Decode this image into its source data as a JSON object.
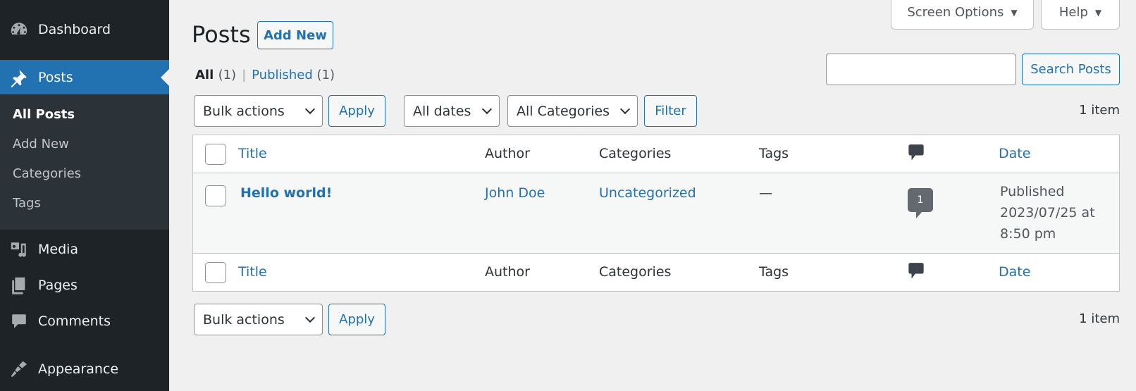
{
  "sidebar": {
    "items": [
      {
        "label": "Dashboard",
        "icon": "dashboard-icon"
      },
      {
        "label": "Posts",
        "icon": "pushpin-icon",
        "current": true
      },
      {
        "label": "Media",
        "icon": "media-icon"
      },
      {
        "label": "Pages",
        "icon": "pages-icon"
      },
      {
        "label": "Comments",
        "icon": "comment-icon"
      },
      {
        "label": "Appearance",
        "icon": "paintbrush-icon"
      }
    ],
    "submenu": [
      {
        "label": "All Posts",
        "current": true
      },
      {
        "label": "Add New"
      },
      {
        "label": "Categories"
      },
      {
        "label": "Tags"
      }
    ]
  },
  "screen_meta": {
    "screen_options": "Screen Options",
    "help": "Help",
    "arrow": "▼"
  },
  "header": {
    "title": "Posts",
    "add_new": "Add New"
  },
  "views": {
    "all_label": "All",
    "all_count": "(1)",
    "separator": "|",
    "published_label": "Published",
    "published_count": "(1)"
  },
  "search": {
    "value": "",
    "button": "Search Posts"
  },
  "tablenav_top": {
    "bulk_actions": "Bulk actions",
    "apply": "Apply",
    "dates": "All dates",
    "categories": "All Categories",
    "filter": "Filter",
    "count": "1 item"
  },
  "tablenav_bottom": {
    "bulk_actions": "Bulk actions",
    "apply": "Apply",
    "count": "1 item"
  },
  "table": {
    "columns": {
      "title": "Title",
      "author": "Author",
      "categories": "Categories",
      "tags": "Tags",
      "comments_icon": "comment-icon",
      "date": "Date"
    },
    "rows": [
      {
        "title": "Hello world!",
        "author": "John Doe",
        "categories": "Uncategorized",
        "tags": "—",
        "comments": "1",
        "date_status": "Published",
        "date_line1": "2023/07/25 at",
        "date_line2": "8:50 pm"
      }
    ]
  },
  "colors": {
    "accent": "#2271b1",
    "sidebar_bg": "#1d2327",
    "submenu_bg": "#2c3338",
    "page_bg": "#f0f0f1"
  }
}
